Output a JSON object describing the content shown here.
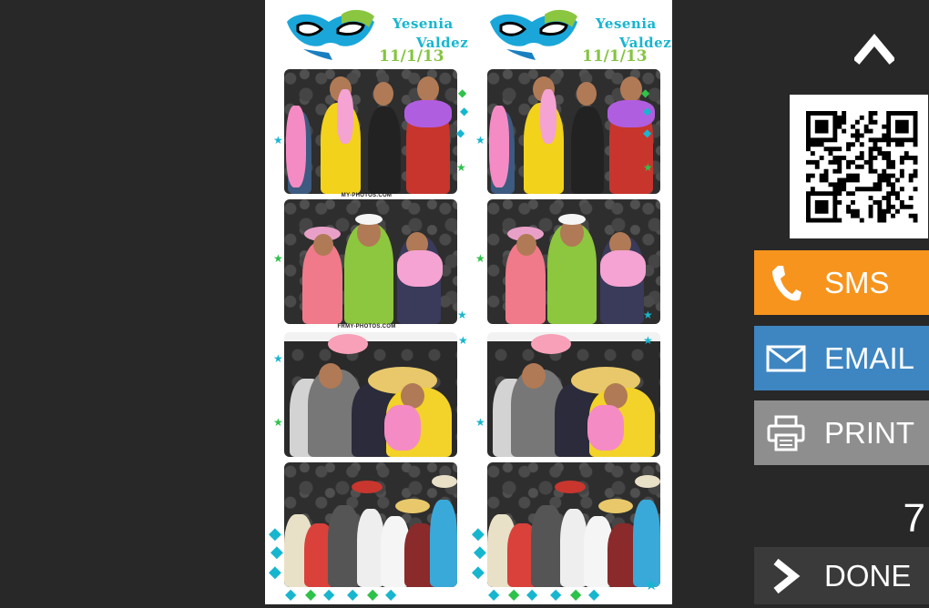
{
  "photo_strip": {
    "header": {
      "name_first": "Yesenia",
      "name_last": "Valdez",
      "date": "11/1/13"
    },
    "credit_1": "MY-PHOTOS.COM",
    "credit_2": "FRMY-PHOTOS.COM"
  },
  "sidebar": {
    "up_icon": "chevron-up-icon",
    "qr_icon": "qr-code-icon",
    "sms_label": "SMS",
    "email_label": "EMAIL",
    "print_label": "PRINT",
    "countdown": "7",
    "done_label": "DONE"
  },
  "colors": {
    "background": "#282828",
    "sms": "#f7941d",
    "email": "#3e86c2",
    "print": "#8e8e8e",
    "done": "#3a3a3a",
    "name_text": "#17b6cf",
    "date_text": "#85c441"
  }
}
